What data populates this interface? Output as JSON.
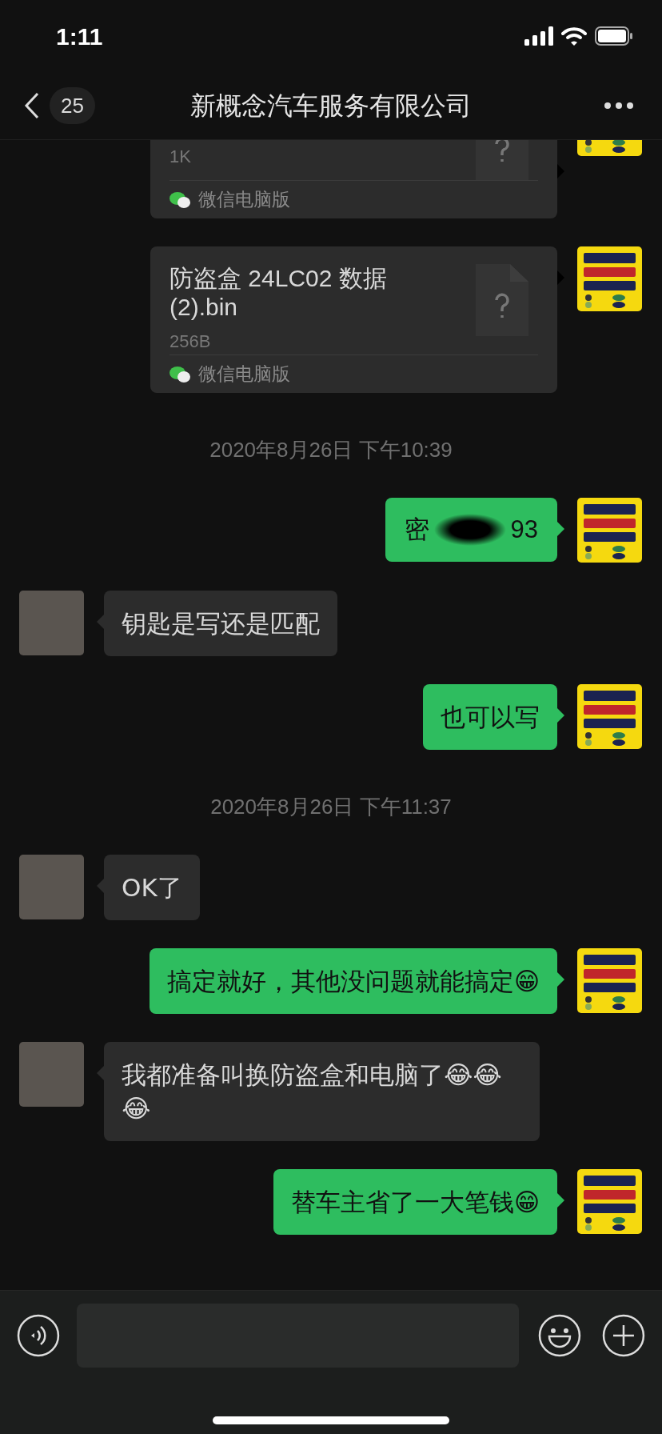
{
  "status_bar": {
    "time": "1:11"
  },
  "nav": {
    "back_count": "25",
    "title": "新概念汽车服务有限公司"
  },
  "messages": [
    {
      "kind": "file",
      "outgoing": true,
      "size": "1K",
      "source": "微信电脑版"
    },
    {
      "kind": "file",
      "outgoing": true,
      "name": "防盗盒 24LC02 数据 (2).bin",
      "size": "256B",
      "source": "微信电脑版"
    },
    {
      "kind": "time",
      "text": "2020年8月26日 下午10:39"
    },
    {
      "kind": "redacted",
      "outgoing": true,
      "parts": [
        "密",
        "93"
      ]
    },
    {
      "kind": "text",
      "outgoing": false,
      "text": "钥匙是写还是匹配"
    },
    {
      "kind": "text",
      "outgoing": true,
      "text": "也可以写"
    },
    {
      "kind": "time",
      "text": "2020年8月26日 下午11:37"
    },
    {
      "kind": "text",
      "outgoing": false,
      "text": "OK了"
    },
    {
      "kind": "text",
      "outgoing": true,
      "text": "搞定就好，其他没问题就能搞定😁"
    },
    {
      "kind": "text",
      "outgoing": false,
      "text": "我都准备叫换防盗盒和电脑了😂😂😂"
    },
    {
      "kind": "text",
      "outgoing": true,
      "text": "替车主省了一大笔钱😁"
    }
  ]
}
